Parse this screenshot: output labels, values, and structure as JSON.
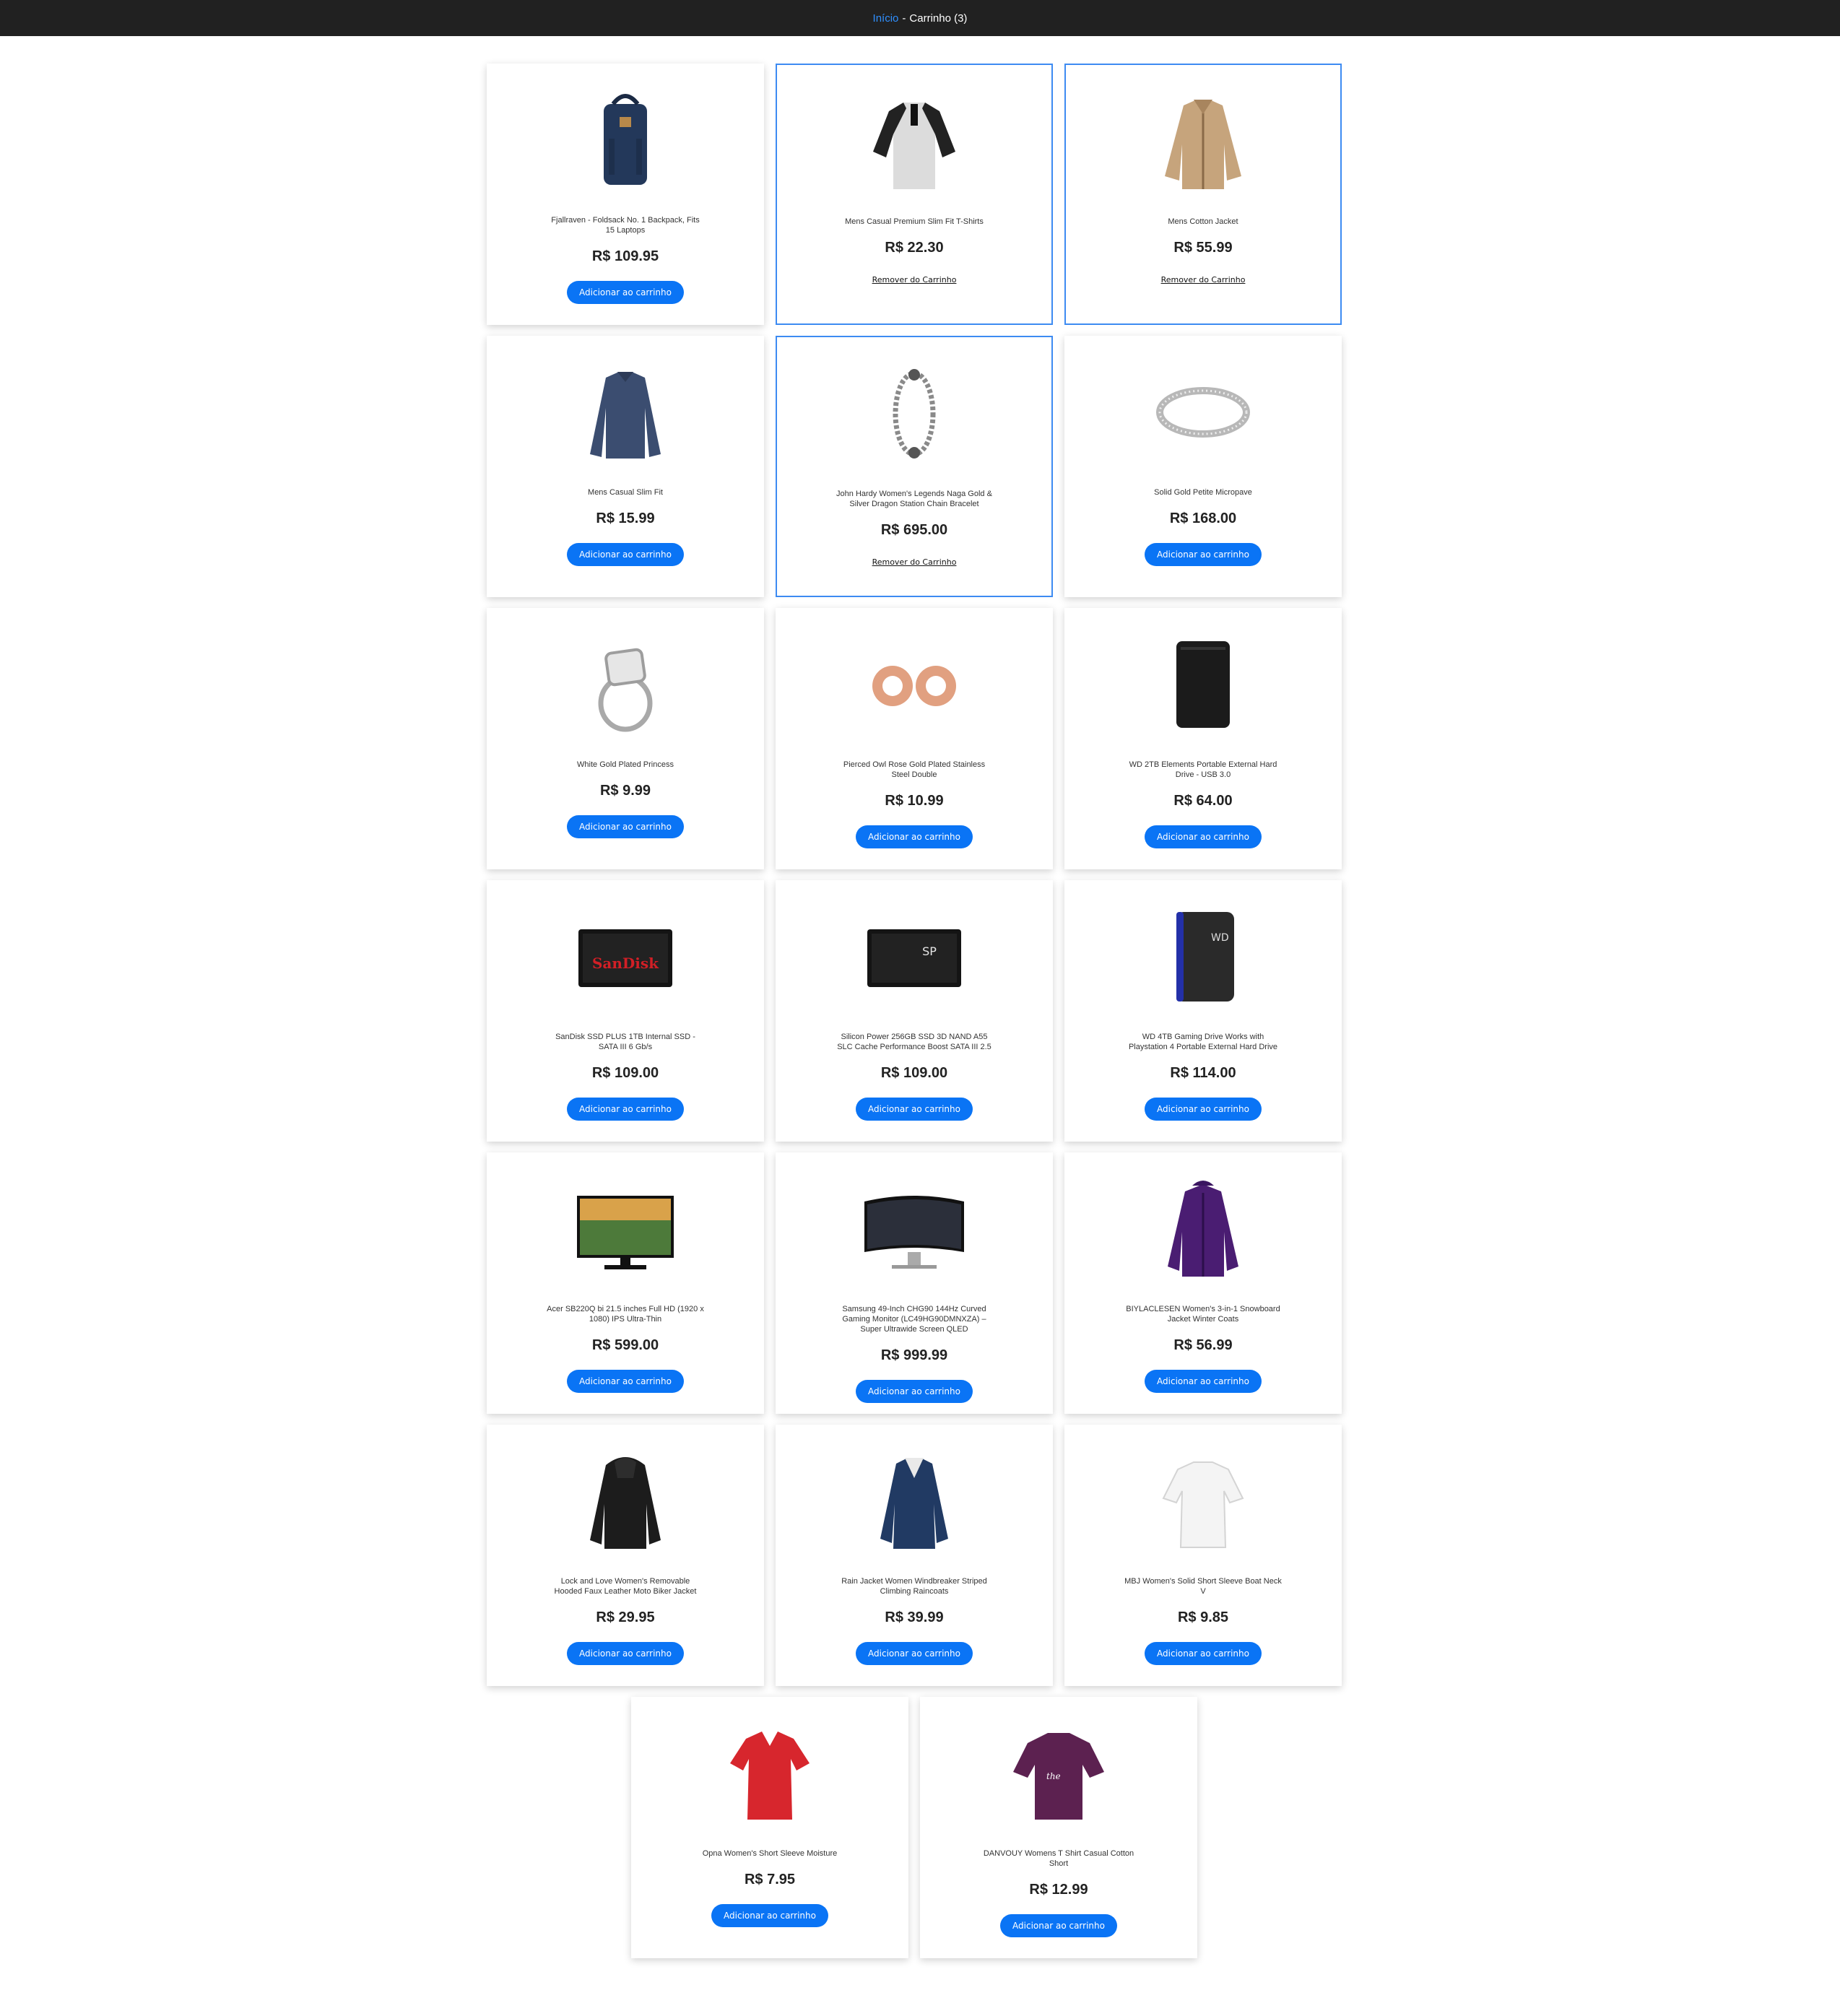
{
  "nav": {
    "home_link": "Início",
    "separator": "-",
    "cart_label": "Carrinho (3)"
  },
  "products": [
    {
      "name": "Fjallraven - Foldsack No. 1 Backpack, Fits 15 Laptops",
      "price": "R$ 109.95",
      "action": "Adicionar ao carrinho",
      "in_cart": false,
      "icon": "backpack-icon"
    },
    {
      "name": "Mens Casual Premium Slim Fit T-Shirts",
      "price": "R$ 22.30",
      "action": "Remover do Carrinho",
      "in_cart": true,
      "icon": "tshirt-icon"
    },
    {
      "name": "Mens Cotton Jacket",
      "price": "R$ 55.99",
      "action": "Remover do Carrinho",
      "in_cart": true,
      "icon": "jacket-icon"
    },
    {
      "name": "Mens Casual Slim Fit",
      "price": "R$ 15.99",
      "action": "Adicionar ao carrinho",
      "in_cart": false,
      "icon": "longsleeve-icon"
    },
    {
      "name": "John Hardy Women's Legends Naga Gold & Silver Dragon Station Chain Bracelet",
      "price": "R$ 695.00",
      "action": "Remover do Carrinho",
      "in_cart": true,
      "icon": "bracelet-icon"
    },
    {
      "name": "Solid Gold Petite Micropave",
      "price": "R$ 168.00",
      "action": "Adicionar ao carrinho",
      "in_cart": false,
      "icon": "ring-band-icon"
    },
    {
      "name": "White Gold Plated Princess",
      "price": "R$ 9.99",
      "action": "Adicionar ao carrinho",
      "in_cart": false,
      "icon": "diamond-ring-icon"
    },
    {
      "name": "Pierced Owl Rose Gold Plated Stainless Steel Double",
      "price": "R$ 10.99",
      "action": "Adicionar ao carrinho",
      "in_cart": false,
      "icon": "earplugs-icon"
    },
    {
      "name": "WD 2TB Elements Portable External Hard Drive - USB 3.0",
      "price": "R$ 64.00",
      "action": "Adicionar ao carrinho",
      "in_cart": false,
      "icon": "hard-drive-icon"
    },
    {
      "name": "SanDisk SSD PLUS 1TB Internal SSD - SATA III 6 Gb/s",
      "price": "R$ 109.00",
      "action": "Adicionar ao carrinho",
      "in_cart": false,
      "icon": "ssd-icon",
      "print": "SanDisk"
    },
    {
      "name": "Silicon Power 256GB SSD 3D NAND A55 SLC Cache Performance Boost SATA III 2.5",
      "price": "R$ 109.00",
      "action": "Adicionar ao carrinho",
      "in_cart": false,
      "icon": "ssd-icon",
      "print": "SP"
    },
    {
      "name": "WD 4TB Gaming Drive Works with Playstation 4 Portable External Hard Drive",
      "price": "R$ 114.00",
      "action": "Adicionar ao carrinho",
      "in_cart": false,
      "icon": "gaming-drive-icon"
    },
    {
      "name": "Acer SB220Q bi 21.5 inches Full HD (1920 x 1080) IPS Ultra-Thin",
      "price": "R$ 599.00",
      "action": "Adicionar ao carrinho",
      "in_cart": false,
      "icon": "monitor-icon"
    },
    {
      "name": "Samsung 49-Inch CHG90 144Hz Curved Gaming Monitor (LC49HG90DMNXZA) – Super Ultrawide Screen QLED",
      "price": "R$ 999.99",
      "action": "Adicionar ao carrinho",
      "in_cart": false,
      "icon": "curved-monitor-icon"
    },
    {
      "name": "BIYLACLESEN Women's 3-in-1 Snowboard Jacket Winter Coats",
      "price": "R$ 56.99",
      "action": "Adicionar ao carrinho",
      "in_cart": false,
      "icon": "winter-coat-icon"
    },
    {
      "name": "Lock and Love Women's Removable Hooded Faux Leather Moto Biker Jacket",
      "price": "R$ 29.95",
      "action": "Adicionar ao carrinho",
      "in_cart": false,
      "icon": "leather-jacket-icon"
    },
    {
      "name": "Rain Jacket Women Windbreaker Striped Climbing Raincoats",
      "price": "R$ 39.99",
      "action": "Adicionar ao carrinho",
      "in_cart": false,
      "icon": "raincoat-icon"
    },
    {
      "name": "MBJ Women's Solid Short Sleeve Boat Neck V",
      "price": "R$ 9.85",
      "action": "Adicionar ao carrinho",
      "in_cart": false,
      "icon": "white-top-icon"
    },
    {
      "name": "Opna Women's Short Sleeve Moisture",
      "price": "R$ 7.95",
      "action": "Adicionar ao carrinho",
      "in_cart": false,
      "icon": "red-shirt-icon"
    },
    {
      "name": "DANVOUY Womens T Shirt Casual Cotton Short",
      "price": "R$ 12.99",
      "action": "Adicionar ao carrinho",
      "in_cart": false,
      "icon": "purple-tee-icon"
    }
  ]
}
